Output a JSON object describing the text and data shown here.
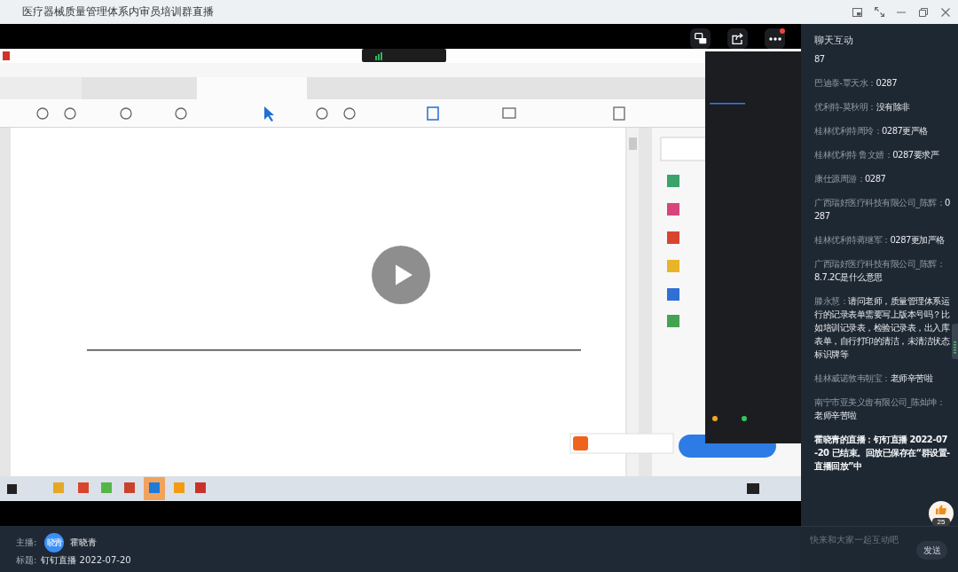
{
  "window": {
    "title": "医疗器械质量管理体系内审员培训群直播"
  },
  "player": {
    "paused": true,
    "buttons": [
      {
        "kind": "translate",
        "notification": false
      },
      {
        "kind": "share",
        "notification": false
      },
      {
        "kind": "more",
        "notification": true
      }
    ]
  },
  "host": {
    "label": "主播:",
    "avatar_text": "晓青",
    "name": "霍晓青"
  },
  "stream_title": {
    "label": "标题:",
    "value": "钉钉直播 2022-07-20"
  },
  "chat": {
    "title": "聊天互动",
    "messages": [
      {
        "kind": "user",
        "text": "87"
      },
      {
        "kind": "user",
        "sender": "巴迪泰-覃天水：",
        "text": "0287"
      },
      {
        "kind": "user",
        "sender": "优利特-莫秋明：",
        "text": "没有除非"
      },
      {
        "kind": "user",
        "sender": "桂林优利特周玲：",
        "text": "0287更严格"
      },
      {
        "kind": "user",
        "sender": "桂林优利特 鲁文婧：",
        "text": "0287要求严"
      },
      {
        "kind": "user",
        "sender": "康仕源周游：",
        "text": "0287"
      },
      {
        "kind": "user",
        "sender": "广西瑞好医疗科技有限公司_陈辉：",
        "text": "0287"
      },
      {
        "kind": "user",
        "sender": "桂林优利特蒋继军：",
        "text": "0287更加严格"
      },
      {
        "kind": "user",
        "sender": "广西瑞好医疗科技有限公司_陈辉：",
        "text": "8.7.2C是什么意思"
      },
      {
        "kind": "user",
        "sender": "滕永慧：",
        "text": "请问老师，质量管理体系运行的记录表单需要写上版本号吗？比如培训记录表，检验记录表，出入库表单，自行打印的清洁，未清洁状态标识牌等"
      },
      {
        "kind": "user",
        "sender": "桂林威诺敦韦朝宝：",
        "text": "老师辛苦啦"
      },
      {
        "kind": "user",
        "sender": "南宁市亚美义齿有限公司_陈灿坤：",
        "text": "老师辛苦啦"
      },
      {
        "kind": "system",
        "text": "霍晓青的直播：钉钉直播 2022-07-20 已结束。回放已保存在“群设置-直播回放”中"
      }
    ],
    "likes": "25",
    "input": {
      "placeholder": "快来和大家一起互动吧"
    },
    "send": "发送"
  }
}
